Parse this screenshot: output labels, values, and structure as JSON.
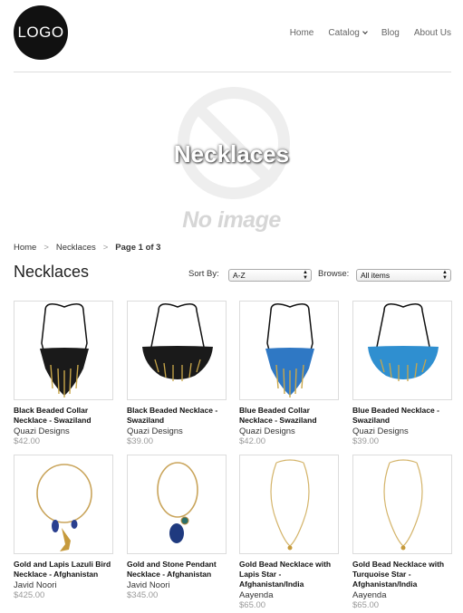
{
  "header": {
    "logo_text": "LOGO",
    "nav": [
      {
        "label": "Home"
      },
      {
        "label": "Catalog"
      },
      {
        "label": "Blog"
      },
      {
        "label": "About Us"
      }
    ]
  },
  "hero": {
    "title": "Necklaces",
    "placeholder_text": "No image"
  },
  "breadcrumb": {
    "home": "Home",
    "separator": ">",
    "collection": "Necklaces",
    "current": "Page 1 of 3"
  },
  "collection": {
    "title": "Necklaces",
    "sort_label": "Sort By:",
    "sort_value": "A-Z",
    "browse_label": "Browse:",
    "browse_value": "All items"
  },
  "products": [
    {
      "name_line1": "Black Beaded Collar",
      "name_line2": "Necklace - Swaziland",
      "name_line3": "",
      "vendor": "Quazi Designs",
      "price": "$42.00"
    },
    {
      "name_line1": "Black Beaded Necklace -",
      "name_line2": "Swaziland",
      "name_line3": "",
      "vendor": "Quazi Designs",
      "price": "$39.00"
    },
    {
      "name_line1": "Blue Beaded Collar",
      "name_line2": "Necklace - Swaziland",
      "name_line3": "",
      "vendor": "Quazi Designs",
      "price": "$42.00"
    },
    {
      "name_line1": "Blue Beaded Necklace -",
      "name_line2": "Swaziland",
      "name_line3": "",
      "vendor": "Quazi Designs",
      "price": "$39.00"
    },
    {
      "name_line1": "Gold and Lapis Lazuli Bird",
      "name_line2": "Necklace - Afghanistan",
      "name_line3": "",
      "vendor": "Javid Noori",
      "price": "$425.00"
    },
    {
      "name_line1": "Gold and Stone Pendant",
      "name_line2": "Necklace - Afghanistan",
      "name_line3": "",
      "vendor": "Javid Noori",
      "price": "$345.00"
    },
    {
      "name_line1": "Gold Bead Necklace with",
      "name_line2": "Lapis Star -",
      "name_line3": "Afghanistan/India",
      "vendor": "Aayenda",
      "price": "$65.00"
    },
    {
      "name_line1": "Gold Bead Necklace with",
      "name_line2": "Turquoise Star -",
      "name_line3": "Afghanistan/India",
      "vendor": "Aayenda",
      "price": "$65.00"
    }
  ],
  "colors": {
    "logo_bg": "#111111",
    "price": "#999999",
    "placeholder": "#eeeeee"
  }
}
